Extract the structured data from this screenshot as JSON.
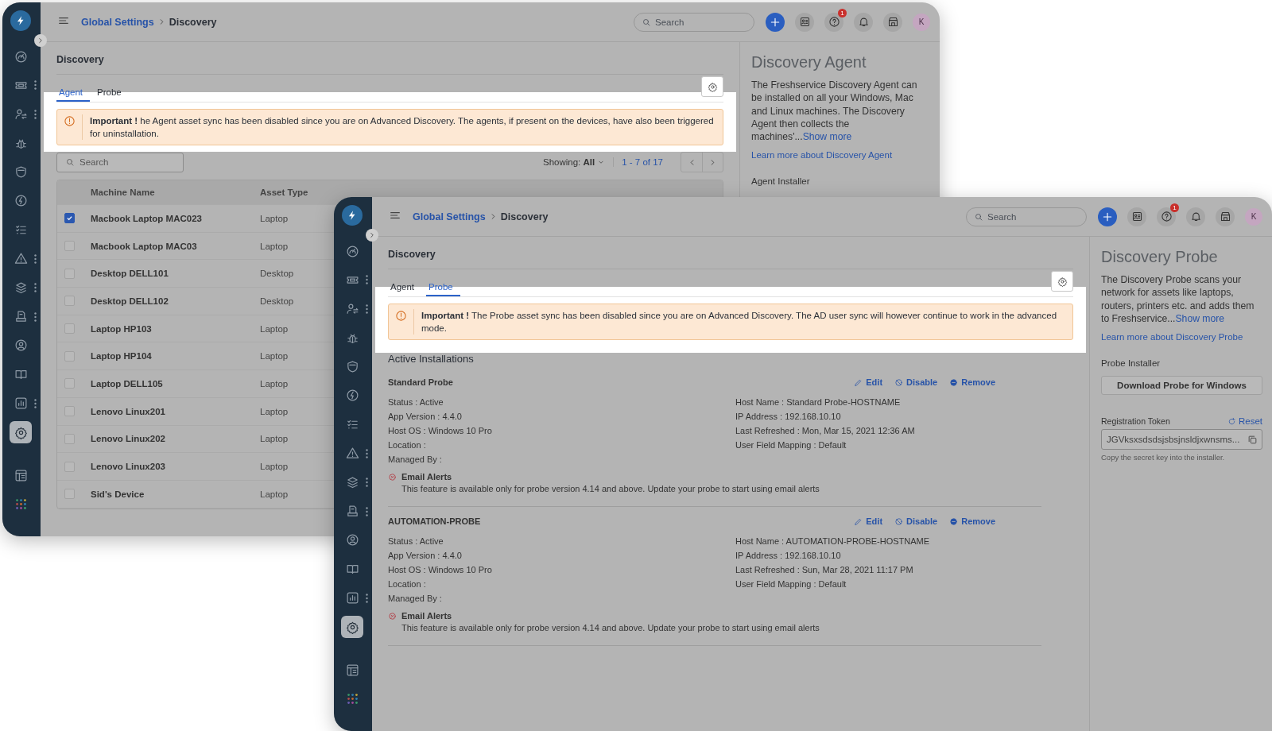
{
  "windows": [
    {
      "kind": "agent",
      "nav": [
        {
          "selected": false
        },
        {
          "selected": false
        },
        {
          "selected": false
        },
        {
          "selected": false
        },
        {
          "selected": false
        },
        {
          "selected": false
        },
        {
          "selected": false
        },
        {
          "selected": false
        },
        {
          "selected": false
        },
        {
          "selected": false
        },
        {
          "selected": false
        },
        {
          "selected": false
        },
        {
          "selected": false
        },
        {
          "selected": true
        },
        {
          "selected": false
        },
        {
          "selected": false
        }
      ],
      "header": {
        "breadcrumb": [
          "Global Settings",
          "Discovery"
        ],
        "search_placeholder": "Search",
        "help_badge": "1",
        "avatar": "K"
      },
      "page_title": "Discovery",
      "tabs": [
        {
          "label": "Agent",
          "selected": true
        },
        {
          "label": "Probe",
          "selected": false
        }
      ],
      "alert": "**Important !** he Agent asset sync has been disabled since you are on Advanced Discovery. The agents, if present on the devices, have also been triggered for uninstallation.",
      "search": {
        "placeholder": "Search"
      },
      "showing": "Showing: **All**",
      "pagination": "1 - 7 of 17",
      "table": {
        "columns": [
          "Machine Name",
          "Asset Type"
        ],
        "rows": [
          {
            "selected": true,
            "cells": [
              "Macbook Laptop MAC023",
              "Laptop"
            ]
          },
          {
            "selected": false,
            "cells": [
              "Macbook Laptop MAC03",
              "Laptop"
            ]
          },
          {
            "selected": false,
            "cells": [
              "Desktop DELL101",
              "Desktop"
            ]
          },
          {
            "selected": false,
            "cells": [
              "Desktop DELL102",
              "Desktop"
            ]
          },
          {
            "selected": false,
            "cells": [
              "Laptop HP103",
              "Laptop"
            ]
          },
          {
            "selected": false,
            "cells": [
              "Laptop HP104",
              "Laptop"
            ]
          },
          {
            "selected": false,
            "cells": [
              "Laptop DELL105",
              "Laptop"
            ]
          },
          {
            "selected": false,
            "cells": [
              "Lenovo Linux201",
              "Laptop"
            ]
          },
          {
            "selected": false,
            "cells": [
              "Lenovo Linux202",
              "Laptop"
            ]
          },
          {
            "selected": false,
            "cells": [
              "Lenovo Linux203",
              "Laptop"
            ]
          },
          {
            "selected": false,
            "cells": [
              "Sid's Device",
              "Laptop"
            ]
          }
        ]
      },
      "panel": {
        "title": "Discovery Agent",
        "description": "The Freshservice Discovery Agent can be installed on all your Windows, Mac and Linux machines. The Discovery Agent then collects the machines'...",
        "show_more": "Show more",
        "learn_more": "Learn more about Discovery Agent",
        "installer_label": "Agent Installer"
      }
    },
    {
      "kind": "probe",
      "nav": [
        {
          "selected": false
        },
        {
          "selected": false
        },
        {
          "selected": false
        },
        {
          "selected": false
        },
        {
          "selected": false
        },
        {
          "selected": false
        },
        {
          "selected": false
        },
        {
          "selected": false
        },
        {
          "selected": false
        },
        {
          "selected": false
        },
        {
          "selected": false
        },
        {
          "selected": false
        },
        {
          "selected": false
        },
        {
          "selected": true
        },
        {
          "selected": false
        },
        {
          "selected": false
        }
      ],
      "header": {
        "breadcrumb": [
          "Global Settings",
          "Discovery"
        ],
        "search_placeholder": "Search",
        "help_badge": "1",
        "avatar": "K"
      },
      "page_title": "Discovery",
      "tabs": [
        {
          "label": "Agent",
          "selected": false
        },
        {
          "label": "Probe",
          "selected": true
        }
      ],
      "alert": "**Important !** The Probe asset sync has been disabled since you are on Advanced Discovery. The AD user sync will however continue to work in the advanced mode.",
      "installations": {
        "title": "Active Installations",
        "probes": [
          {
            "name": "Standard Probe",
            "actions": [
              "Edit",
              "Disable",
              "Remove"
            ],
            "left": [
              "Status : Active",
              "App Version : 4.4.0",
              "Host OS : Windows 10 Pro",
              "Location :",
              "Managed By :"
            ],
            "right": [
              "Host Name : Standard Probe-HOSTNAME",
              "IP Address : 192.168.10.10",
              "Last Refreshed : Mon, Mar 15, 2021 12:36 AM",
              "User Field Mapping : Default"
            ],
            "email_alerts": {
              "label": "Email Alerts",
              "note": "This feature is available only for probe version 4.14 and above. Update your probe to start using email alerts"
            }
          },
          {
            "name": "AUTOMATION-PROBE",
            "actions": [
              "Edit",
              "Disable",
              "Remove"
            ],
            "left": [
              "Status : Active",
              "App Version : 4.4.0",
              "Host OS : Windows 10 Pro",
              "Location :",
              "Managed By :"
            ],
            "right": [
              "Host Name : AUTOMATION-PROBE-HOSTNAME",
              "IP Address : 192.168.10.10",
              "Last Refreshed : Sun, Mar 28, 2021 11:17 PM",
              "User Field Mapping : Default"
            ],
            "email_alerts": {
              "label": "Email Alerts",
              "note": "This feature is available only for probe version 4.14 and above. Update your probe to start using email alerts"
            }
          }
        ]
      },
      "panel": {
        "title": "Discovery Probe",
        "description": "The Discovery Probe scans your network for assets like laptops, routers, printers etc. and adds them to Freshservice...",
        "show_more": "Show more",
        "learn_more": "Learn more about Discovery Probe",
        "installer_label": "Probe Installer",
        "download_button": "Download Probe for Windows",
        "token": {
          "label": "Registration Token",
          "reset": "Reset",
          "value": "JGVksxsdsdsjsbsjnsldjxwnsms...",
          "hint": "Copy the secret key into the installer."
        }
      }
    }
  ]
}
